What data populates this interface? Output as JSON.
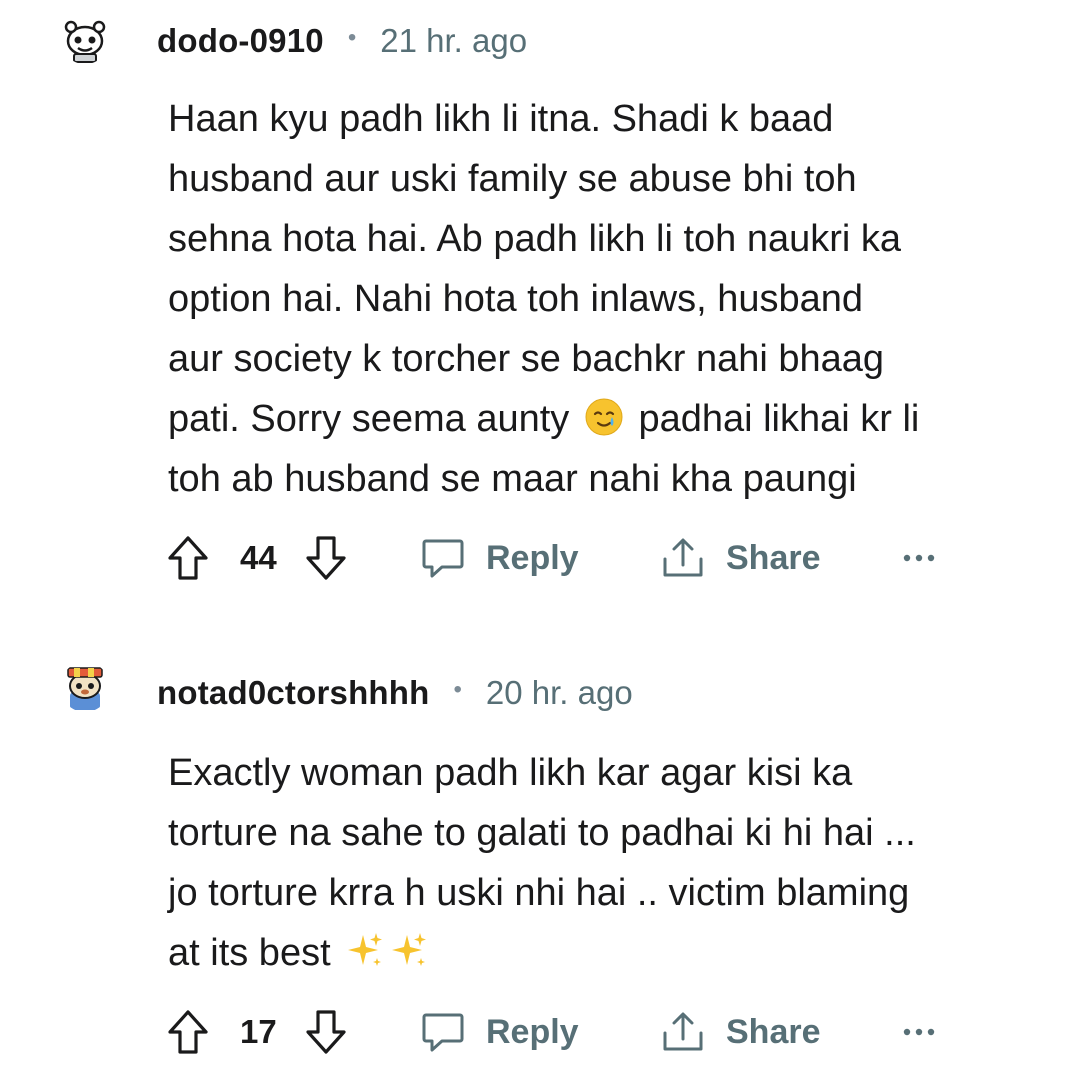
{
  "comments": [
    {
      "username": "dodo-0910",
      "separator": "•",
      "time": "21 hr. ago",
      "lines": [
        "Haan kyu padh likh li itna. Shadi k baad",
        "husband aur uski family se abuse bhi toh",
        "sehna hota hai. Ab padh likh li toh naukri ka",
        "option hai. Nahi hota toh inlaws, husband",
        "aur society k torcher se bachkr nahi bhaag"
      ],
      "line6_before_emoji": "pati. Sorry seema aunty",
      "emoji": "smiling-face-with-tear-icon",
      "line6_after_emoji": "padhai likhai kr li",
      "line7": "toh ab husband se maar nahi kha paungi",
      "score": "44",
      "reply_label": "Reply",
      "share_label": "Share"
    },
    {
      "username": "notad0ctorshhhh",
      "separator": "•",
      "time": "20 hr. ago",
      "lines": [
        "Exactly woman padh likh kar agar kisi ka",
        "torture na sahe to galati to padhai ki hi hai ...",
        "jo torture krra h uski nhi hai .. victim blaming"
      ],
      "line4_before_emoji": "at its best",
      "emoji": "sparkles-icon",
      "score": "17",
      "reply_label": "Reply",
      "share_label": "Share"
    }
  ],
  "colors": {
    "text": "#1a1a1b",
    "meta": "#576f76",
    "icon": "#1a1a1b"
  }
}
